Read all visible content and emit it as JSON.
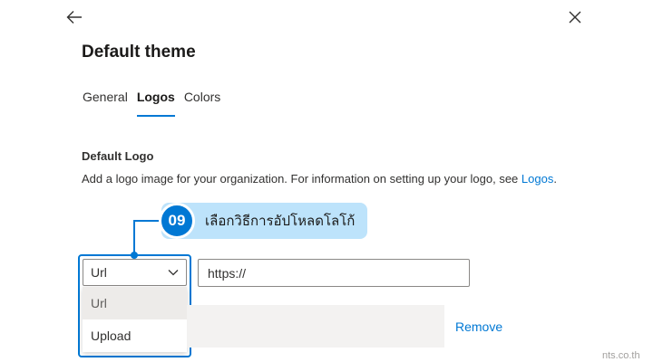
{
  "header": {
    "back_icon": "arrow-left-icon",
    "close_icon": "close-icon",
    "title": "Default theme"
  },
  "tabs": [
    {
      "label": "General",
      "active": false
    },
    {
      "label": "Logos",
      "active": true
    },
    {
      "label": "Colors",
      "active": false
    }
  ],
  "section": {
    "title": "Default Logo",
    "description": "Add a logo image for your organization. For information on setting up your logo, see",
    "link": "Logos",
    "link_suffix": "."
  },
  "callout": {
    "step": "09",
    "text": "เลือกวิธีการอัปโหลดโลโก้"
  },
  "logo_source": {
    "selected": "Url",
    "options": [
      "Url",
      "Upload"
    ]
  },
  "url_field": {
    "value": "https://"
  },
  "preview": {
    "remove_label": "Remove"
  },
  "watermark": "nts.co.th",
  "colors": {
    "accent": "#0078d4",
    "callout_bg": "#bde3fb"
  }
}
